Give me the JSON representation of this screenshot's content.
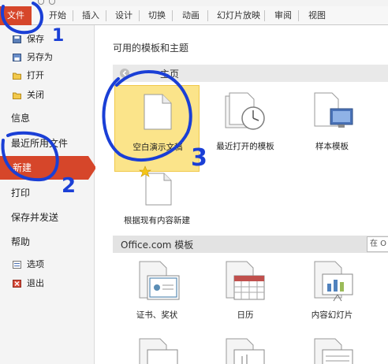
{
  "ribbon": {
    "file_tab": "文件",
    "tabs": [
      "开始",
      "插入",
      "设计",
      "切换",
      "动画",
      "幻灯片放映",
      "审阅",
      "视图"
    ]
  },
  "backstage_menu": {
    "save": "保存",
    "save_as": "另存为",
    "open": "打开",
    "close": "关闭",
    "info": "信息",
    "recent": "最近所用文件",
    "new": "新建",
    "print": "打印",
    "save_and_send": "保存并发送",
    "help": "帮助",
    "options": "选项",
    "exit": "退出"
  },
  "main": {
    "section_title": "可用的模板和主题",
    "home_band_label": "主页",
    "templates": [
      {
        "label": "空白演示文稿",
        "icon": "blank-document-icon"
      },
      {
        "label": "最近打开的模板",
        "icon": "recent-templates-clock-icon"
      },
      {
        "label": "样本模板",
        "icon": "sample-templates-monitor-icon"
      },
      {
        "label": "根据现有内容新建",
        "icon": "new-from-existing-icon"
      }
    ],
    "office_band_label": "Office.com 模板",
    "search_placeholder": "在 O",
    "office_templates": [
      {
        "label": "证书、奖状",
        "icon": "certificate-icon"
      },
      {
        "label": "日历",
        "icon": "calendar-icon"
      },
      {
        "label": "内容幻灯片",
        "icon": "content-slides-icon"
      }
    ]
  },
  "annotations": [
    "1",
    "2",
    "3"
  ],
  "colors": {
    "accent": "#d6462a",
    "selected_tile": "#fbe48a",
    "annotation_ink": "#1a3fd6"
  }
}
